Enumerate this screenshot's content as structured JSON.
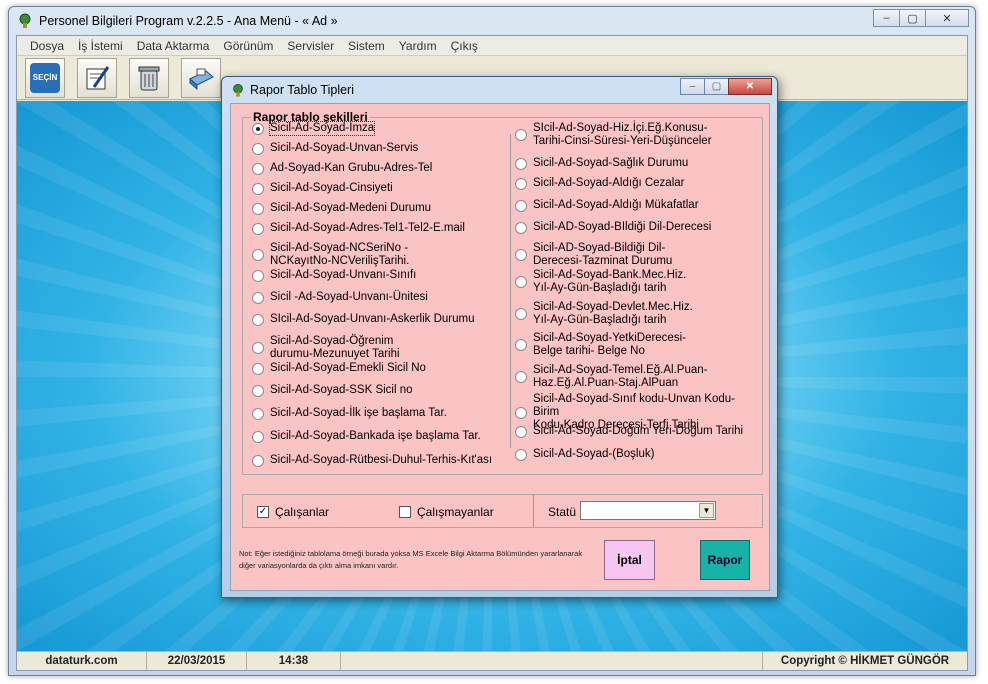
{
  "main_window": {
    "title": "Personel Bilgileri Program v.2.2.5  - Ana Menü -  « Ad »",
    "controls": [
      "–",
      "▢",
      "✕"
    ]
  },
  "menubar": {
    "items": [
      "Dosya",
      "İş İstemi",
      "Data Aktarma",
      "Görünüm",
      "Servisler",
      "Sistem",
      "Yardım",
      "Çıkış"
    ]
  },
  "toolbar": {
    "buttons": [
      {
        "icon": "secin-icon",
        "label": "SEÇİN"
      },
      {
        "icon": "edit-form-icon"
      },
      {
        "icon": "recycle-bin-icon"
      },
      {
        "icon": "printer-icon"
      }
    ]
  },
  "statusbar": {
    "site": "dataturk.com",
    "date": "22/03/2015",
    "time": "14:38",
    "copyright": "Copyright © HİKMET GÜNGÖR"
  },
  "dialog": {
    "title": "Rapor Tablo Tipleri",
    "controls": [
      "–",
      "▢",
      "✕"
    ],
    "group_title": "Rapor tablo şekilleri",
    "left_options": [
      [
        "Sicil-Ad-Soyad-İmza"
      ],
      [
        "Sicil-Ad-Soyad-Unvan-Servis"
      ],
      [
        "Ad-Soyad-Kan Grubu-Adres-Tel"
      ],
      [
        "Sicil-Ad-Soyad-Cinsiyeti"
      ],
      [
        "Sicil-Ad-Soyad-Medeni Durumu"
      ],
      [
        "Sicil-Ad-Soyad-Adres-Tel1-Tel2-E.mail"
      ],
      [
        "Sicil-Ad-Soyad-NCSeriNo -",
        "NCKayıtNo-NCVerilişTarihi."
      ],
      [
        "Sicil-Ad-Soyad-Unvanı-Sınıfı"
      ],
      [
        "Sicil -Ad-Soyad-Unvanı-Ünitesi"
      ],
      [
        "SIcil-Ad-Soyad-Unvanı-Askerlik Durumu"
      ],
      [
        "Sicil-Ad-Soyad-Öğrenim",
        "durumu-Mezunuyet Tarihi"
      ],
      [
        "Sicil-Ad-Soyad-Emekli Sicil No"
      ],
      [
        "Sicil-Ad-Soyad-SSK Sicil no"
      ],
      [
        "Sicil-Ad-Soyad-İlk işe başlama Tar."
      ],
      [
        "Sicil-Ad-Soyad-Bankada işe başlama Tar."
      ],
      [
        "Sicil-Ad-Soyad-Rütbesi-Duhul-Terhis-Kıt'ası"
      ]
    ],
    "right_options": [
      [
        "SIcil-Ad-Soyad-Hiz.İçi.Eğ.Konusu-",
        "Tarihi-Cinsi-Süresi-Yeri-Düşünceler"
      ],
      [
        "Sicil-Ad-Soyad-Sağlık Durumu"
      ],
      [
        "Sicil-Ad-Soyad-Aldığı Cezalar"
      ],
      [
        "Sicil-Ad-Soyad-Aldığı Mükafatlar"
      ],
      [
        "Sicil-AD-Soyad-BIldiği Dil-Derecesi"
      ],
      [
        "Sicil-AD-Soyad-Bildiği Dil-",
        "Derecesi-Tazminat Durumu"
      ],
      [
        "Sicil-Ad-Soyad-Bank.Mec.Hiz.",
        "Yıl-Ay-Gün-Başladığı tarih"
      ],
      [
        "Sicil-Ad-Soyad-Devlet.Mec.Hiz.",
        "Yıl-Ay-Gün-Başladığı tarih"
      ],
      [
        "Sicil-Ad-Soyad-YetkiDerecesi-",
        "Belge tarihi- Belge No"
      ],
      [
        "Sicil-Ad-Soyad-Temel.Eğ.Al.Puan-",
        "Haz.Eğ.Al.Puan-Staj.AlPuan"
      ],
      [
        "Sicil-Ad-Soyad-Sınıf kodu-Unvan Kodu- Birim",
        "Kodu-Kadro Derecesi-Terfi Tarihi"
      ],
      [
        "Sicil-Ad-Soyad-Doğum Yeri-Doğum Tarihi"
      ],
      [
        "Sicil-Ad-Soyad-(Boşluk)"
      ]
    ],
    "selected_index": 0,
    "calisanlar_label": "Çalışanlar",
    "calisanlar_checked": true,
    "calismayanlar_label": "Çalışmayanlar",
    "calismayanlar_checked": false,
    "statu_label": "Statü",
    "statu_value": "",
    "note": "Not: Eğer istediğiniz tablolama örneği burada yoksa MS Excele Bilgi Aktarma Bölümünden yararlanarak diğer variasyonlarda da çıktı alma imkanı vardır.",
    "iptal_label": "İptal",
    "rapor_label": "Rapor"
  },
  "colors": {
    "dialog_body": "#fbc4c4",
    "iptal": "#f7c6f0",
    "rapor": "#19b2a8",
    "desktop": "#32b3e6"
  }
}
